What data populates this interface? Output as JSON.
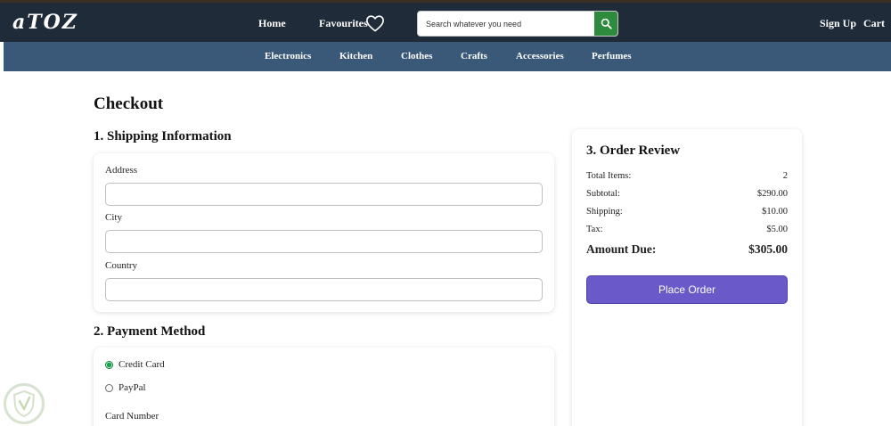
{
  "header": {
    "logo": "aTOZ",
    "nav": {
      "home": "Home",
      "favourites": "Favourites",
      "sign_up": "Sign Up",
      "cart": "Cart"
    },
    "search": {
      "placeholder": "Search whatever you need"
    }
  },
  "categories": [
    "Electronics",
    "Kitchen",
    "Clothes",
    "Crafts",
    "Accessories",
    "Perfumes"
  ],
  "checkout": {
    "title": "Checkout",
    "shipping": {
      "title": "1. Shipping Information",
      "fields": [
        {
          "label": "Address",
          "value": ""
        },
        {
          "label": "City",
          "value": ""
        },
        {
          "label": "Country",
          "value": ""
        }
      ]
    },
    "payment": {
      "title": "2. Payment Method",
      "options": [
        {
          "label": "Credit Card",
          "selected": true
        },
        {
          "label": "PayPal",
          "selected": false
        }
      ],
      "card_number_label": "Card Number"
    },
    "review": {
      "title": "3. Order Review",
      "rows": [
        {
          "label": "Total Items:",
          "value": "2"
        },
        {
          "label": "Subtotal:",
          "value": "$290.00"
        },
        {
          "label": "Shipping:",
          "value": "$10.00"
        },
        {
          "label": "Tax:",
          "value": "$5.00"
        }
      ],
      "total": {
        "label": "Amount Due:",
        "value": "$305.00"
      },
      "button": "Place Order"
    }
  },
  "colors": {
    "topbar": "#1f2b38",
    "catbar": "#3a5878",
    "search_button": "#2e8b3e",
    "place_order": "#6a59c8",
    "radio_selected": "#17a34a"
  },
  "icons": {
    "favourites": "heart-icon",
    "search": "search-icon",
    "watermark": "shield-logo-icon"
  }
}
